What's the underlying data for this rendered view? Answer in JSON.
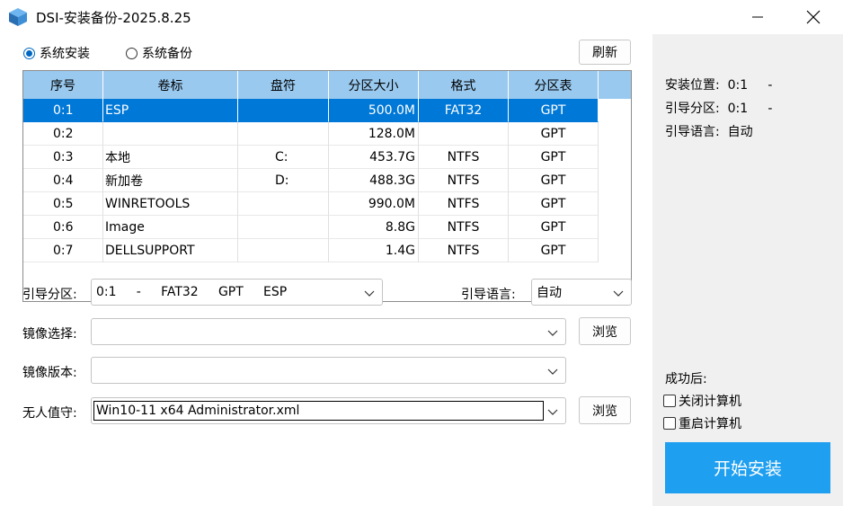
{
  "window": {
    "title": "DSI-安装备份-2025.8.25"
  },
  "modes": [
    {
      "label": "系统安装",
      "selected": true
    },
    {
      "label": "系统备份",
      "selected": false
    }
  ],
  "refresh_label": "刷新",
  "table": {
    "headers": [
      "序号",
      "卷标",
      "盘符",
      "分区大小",
      "格式",
      "分区表"
    ],
    "rows": [
      {
        "index": "0:1",
        "label": "ESP",
        "drive": "",
        "size": "500.0M",
        "format": "FAT32",
        "scheme": "GPT",
        "selected": true
      },
      {
        "index": "0:2",
        "label": "",
        "drive": "",
        "size": "128.0M",
        "format": "",
        "scheme": "GPT"
      },
      {
        "index": "0:3",
        "label": "本地",
        "drive": "C:",
        "size": "453.7G",
        "format": "NTFS",
        "scheme": "GPT"
      },
      {
        "index": "0:4",
        "label": "新加卷",
        "drive": "D:",
        "size": "488.3G",
        "format": "NTFS",
        "scheme": "GPT"
      },
      {
        "index": "0:5",
        "label": "WINRETOOLS",
        "drive": "",
        "size": "990.0M",
        "format": "NTFS",
        "scheme": "GPT"
      },
      {
        "index": "0:6",
        "label": "Image",
        "drive": "",
        "size": "8.8G",
        "format": "NTFS",
        "scheme": "GPT"
      },
      {
        "index": "0:7",
        "label": "DELLSUPPORT",
        "drive": "",
        "size": "1.4G",
        "format": "NTFS",
        "scheme": "GPT"
      }
    ]
  },
  "form": {
    "boot_partition_label": "引导分区:",
    "boot_partition_value": "0:1     -     FAT32     GPT     ESP",
    "boot_language_label": "引导语言:",
    "boot_language_value": "自动",
    "image_select_label": "镜像选择:",
    "image_select_value": "",
    "image_version_label": "镜像版本:",
    "image_version_value": "",
    "unattend_label": "无人值守:",
    "unattend_value": "Win10-11 x64 Administrator.xml",
    "browse_label": "浏览"
  },
  "side": {
    "install_location": "安装位置:  0:1     -",
    "boot_partition": "引导分区:  0:1     -",
    "boot_language": "引导语言:  自动",
    "after_success": "成功后:",
    "shutdown": "关闭计算机",
    "restart": "重启计算机",
    "start_label": "开始安装"
  },
  "colors": {
    "accent": "#0078d7",
    "header_bg": "#99c9ef",
    "start_button": "#1e9ff0",
    "side_bg": "#f0f0f0"
  }
}
